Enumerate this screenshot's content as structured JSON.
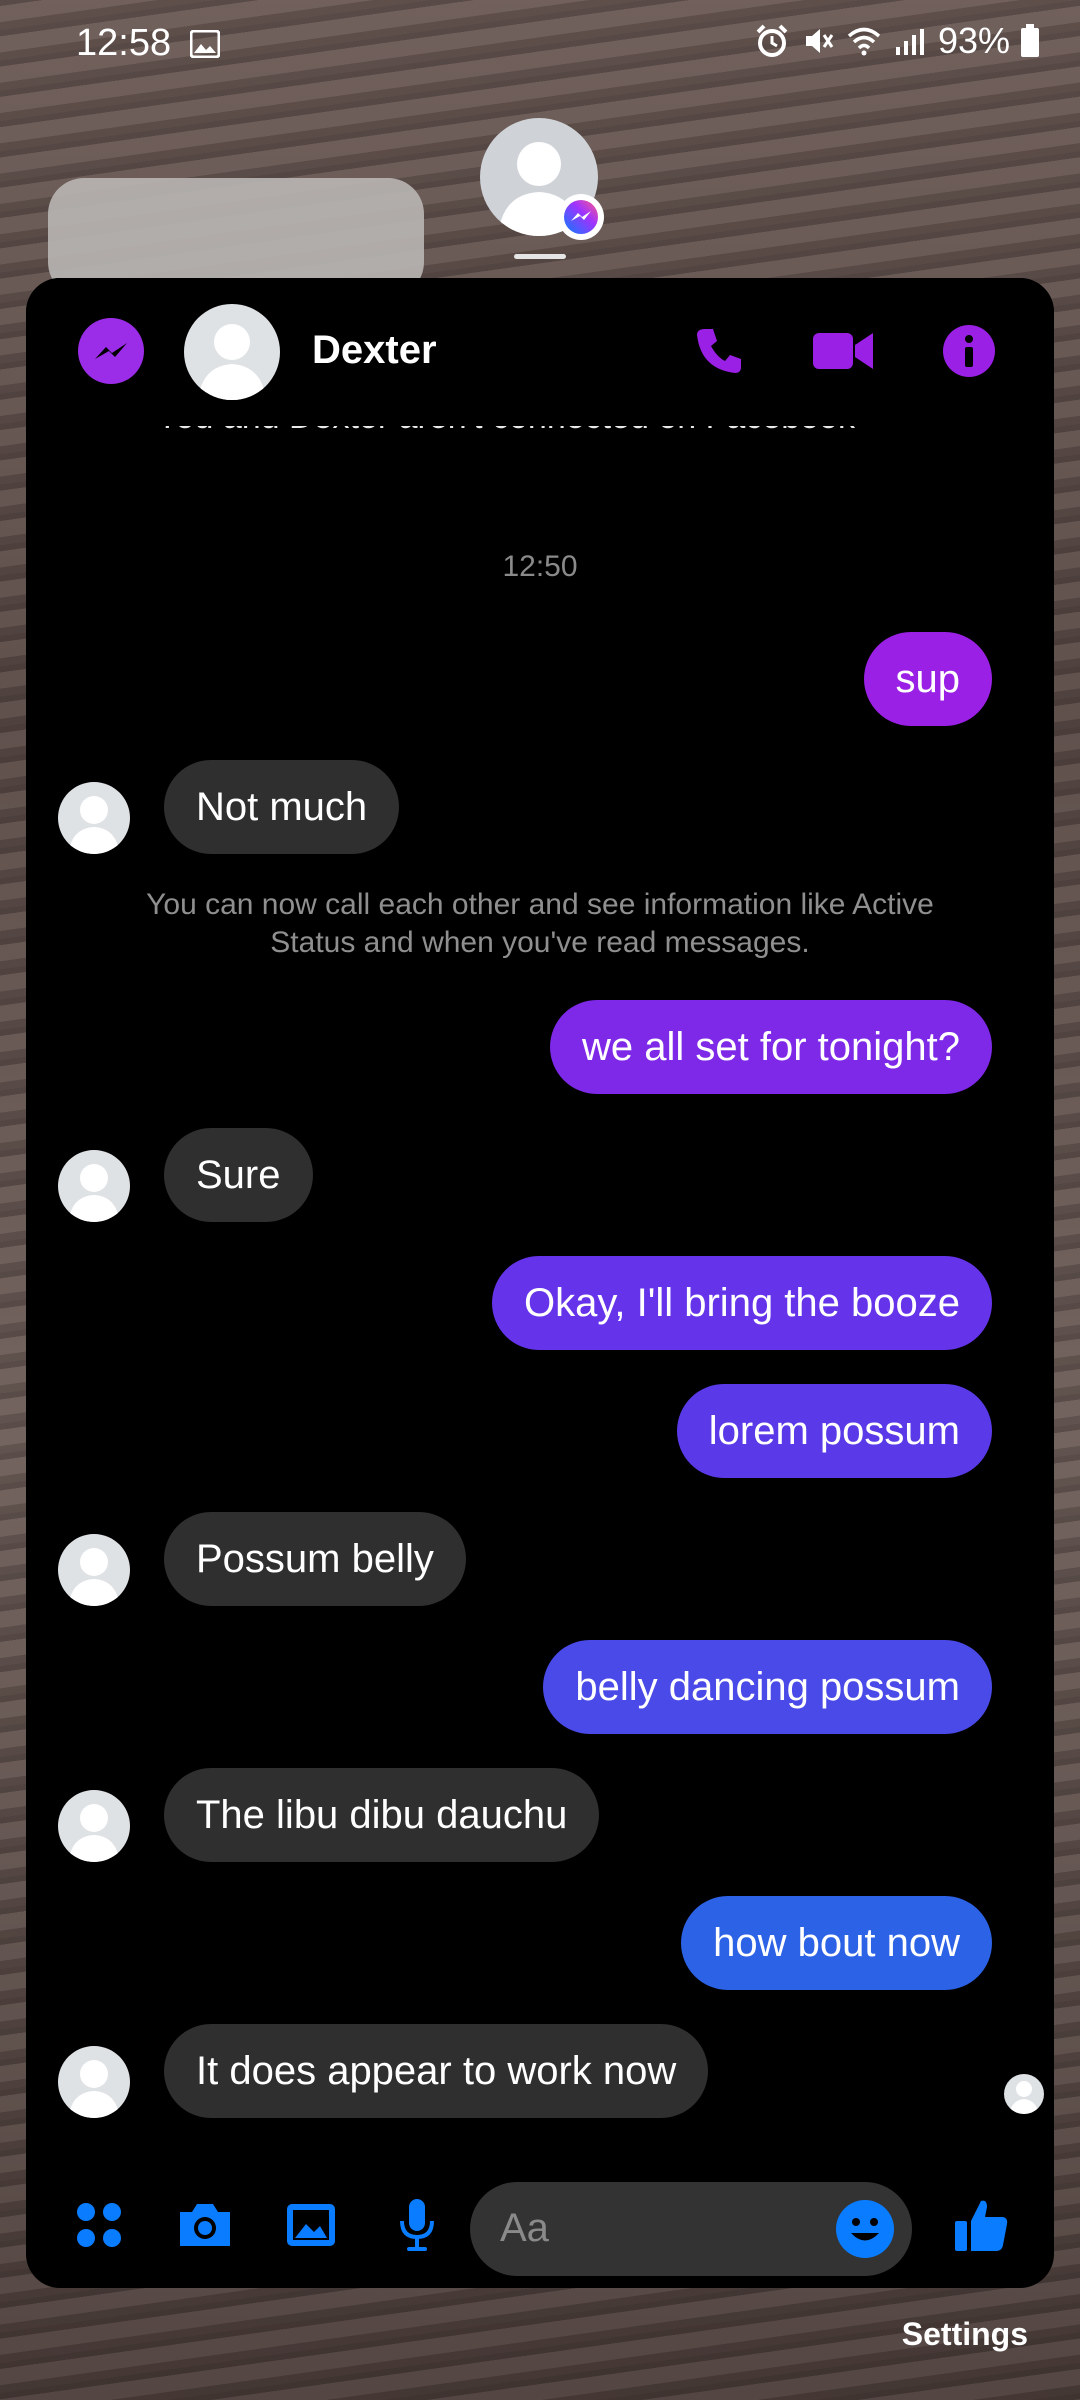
{
  "status_bar": {
    "time": "12:58",
    "battery": "93%",
    "icons": [
      "gallery-icon",
      "alarm-icon",
      "mute-icon",
      "wifi-icon",
      "signal-icon",
      "battery-icon"
    ]
  },
  "chat": {
    "contact_name": "Dexter",
    "cut_off_text": "You and Dexter aren't connected on Facebook",
    "timestamp": "12:50",
    "system_message": "You can now call each other and see information like Active Status and when you've read messages.",
    "messages": [
      {
        "dir": "out",
        "text": "sup",
        "color": "#9b20e6"
      },
      {
        "dir": "in",
        "text": "Not much"
      },
      {
        "dir": "out",
        "text": "we all set for tonight?",
        "color": "#7e28e8"
      },
      {
        "dir": "in",
        "text": "Sure"
      },
      {
        "dir": "out",
        "text": "Okay, I'll bring the booze",
        "color": "#6534ea"
      },
      {
        "dir": "out",
        "text": "lorem possum",
        "color": "#5a3ae8"
      },
      {
        "dir": "in",
        "text": "Possum belly"
      },
      {
        "dir": "out",
        "text": "belly dancing possum",
        "color": "#4a4ae8"
      },
      {
        "dir": "in",
        "text": "The libu dibu dauchu"
      },
      {
        "dir": "out",
        "text": "how bout now",
        "color": "#2c62e6"
      },
      {
        "dir": "in",
        "text": "It does appear to work now"
      }
    ]
  },
  "composer": {
    "placeholder": "Aa"
  },
  "bottom": {
    "settings_label": "Settings"
  },
  "colors": {
    "accent_purple": "#9b20e6",
    "accent_blue": "#0a7cff",
    "incoming_bubble": "#2f2f2f"
  }
}
